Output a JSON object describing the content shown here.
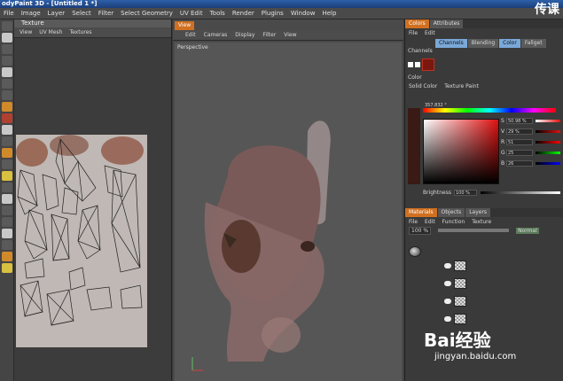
{
  "window": {
    "title": "odyPaint 3D - [Untitled 1 *]"
  },
  "menubar": [
    "File",
    "Image",
    "Layer",
    "Select",
    "Filter",
    "Select Geometry",
    "UV Edit",
    "Tools",
    "Render",
    "Plugins",
    "Window",
    "Help"
  ],
  "texture_panel": {
    "title": "Texture",
    "menu": [
      "View",
      "UV Mesh",
      "Textures"
    ]
  },
  "view_panel": {
    "tab": "View",
    "menu": [
      "Edit",
      "Cameras",
      "Display",
      "Filter",
      "View"
    ],
    "viewport_label": "Perspective"
  },
  "colors_panel": {
    "tabs": [
      "Colors",
      "Attributes"
    ],
    "menu": [
      "File",
      "Edit"
    ],
    "channel_tabs": [
      "Channels",
      "Blending",
      "Color",
      "Fallget"
    ],
    "channels_label": "Channels",
    "color_label": "Color",
    "color_modes": [
      "Solid Color",
      "Texture Paint"
    ],
    "hue_value": "357.832 °",
    "sliders": [
      {
        "key": "S",
        "value": "50.98 %"
      },
      {
        "key": "V",
        "value": "29 %"
      },
      {
        "key": "R",
        "value": "51"
      },
      {
        "key": "G",
        "value": "25"
      },
      {
        "key": "B",
        "value": "26"
      }
    ],
    "brightness_label": "Brightness",
    "brightness_value": "100 %"
  },
  "materials_panel": {
    "tabs": [
      "Materials",
      "Objects",
      "Layers"
    ],
    "menu": [
      "File",
      "Edit",
      "Function",
      "Texture"
    ],
    "opacity_value": "100 %",
    "blend_mode": "Normal"
  },
  "watermarks": {
    "top_right": "传课",
    "baidu": "Bai经验",
    "baidu_url": "jingyan.baidu.com"
  },
  "colors": {
    "accent_tab": "#d07020",
    "selected_tab": "#7aa8d8",
    "active_color": "#7a1810"
  }
}
